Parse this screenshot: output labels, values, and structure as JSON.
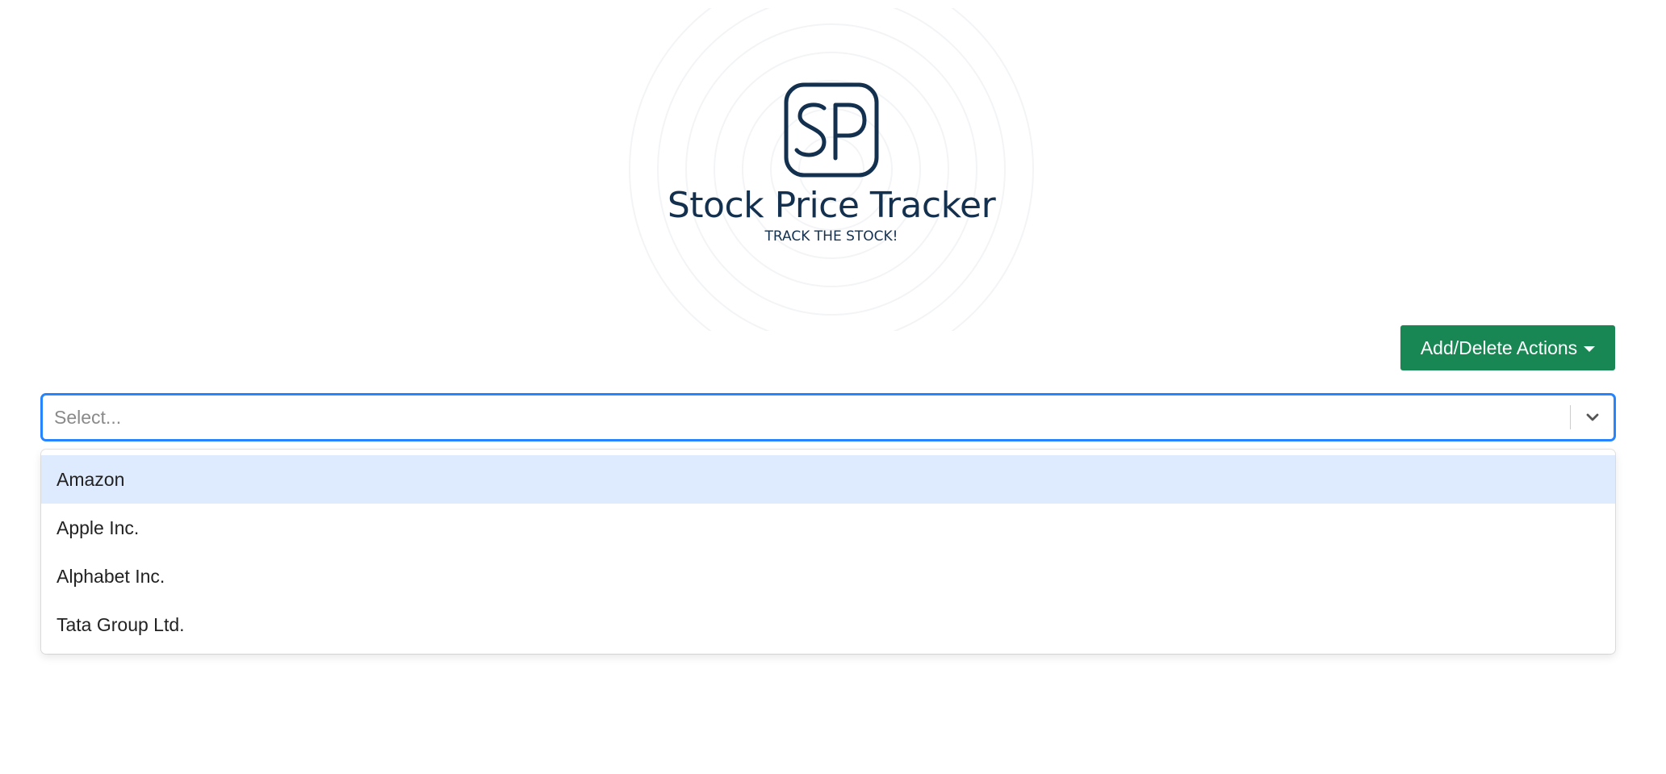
{
  "header": {
    "logo_monogram": "SP",
    "title": "Stock Price Tracker",
    "tagline": "TRACK THE STOCK!"
  },
  "actions": {
    "button_label": "Add/Delete Actions",
    "button_icon": "caret-down-icon"
  },
  "select": {
    "placeholder": "Select...",
    "value": "",
    "options": [
      {
        "label": "Amazon",
        "focused": true
      },
      {
        "label": "Apple Inc.",
        "focused": false
      },
      {
        "label": "Alphabet Inc.",
        "focused": false
      },
      {
        "label": "Tata Group Ltd.",
        "focused": false
      }
    ]
  },
  "colors": {
    "brand_navy": "#14304f",
    "action_green": "#198754",
    "focus_blue": "#2684ff",
    "option_focus_bg": "#deebff"
  }
}
